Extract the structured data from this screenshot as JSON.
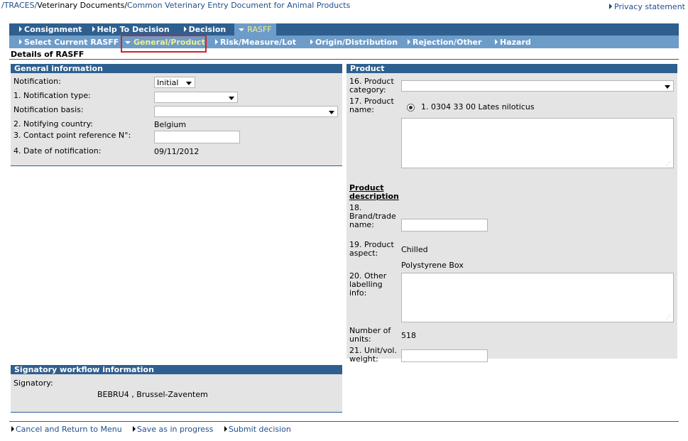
{
  "breadcrumb": {
    "part1": "/TRACES/",
    "part2": "Veterinary Documents/",
    "part3": "Common Veterinary Entry Document for Animal Products"
  },
  "privacy": "Privacy statement",
  "main_tabs": [
    "Consignment",
    "Help To Decision",
    "Decision",
    "RASFF"
  ],
  "sub_tabs": [
    "Select Current RASFF",
    "General/Product",
    "Risk/Measure/Lot",
    "Origin/Distribution",
    "Rejection/Other",
    "Hazard"
  ],
  "details_title": "Details of RASFF",
  "general": {
    "heading": "General information",
    "notification_label": "Notification:",
    "notification_value": "Initial",
    "type_label": "1. Notification type:",
    "type_value": "",
    "basis_label": "Notification basis:",
    "basis_value": "",
    "country_label": "2. Notifying country:",
    "country_value": "Belgium",
    "contact_label": "3. Contact point reference N°:",
    "contact_value": "",
    "date_label": "4. Date of notification:",
    "date_value": "09/11/2012"
  },
  "product": {
    "heading": "Product",
    "category_label1": "16. Product",
    "category_label2": "category:",
    "name_label1": "17. Product",
    "name_label2": "name:",
    "name_option": "1. 0304 33 00 Lates niloticus",
    "description_heading1": "Product",
    "description_heading2": "description",
    "brand_label1": "18.",
    "brand_label2": "Brand/trade",
    "brand_label3": "name:",
    "aspect_label1": "19. Product",
    "aspect_label2": "aspect:",
    "aspect_value": "Chilled",
    "packaging_value": "Polystyrene Box",
    "other_label1": "20. Other",
    "other_label2": "labelling",
    "other_label3": "info:",
    "units_label1": "Number of",
    "units_label2": "units:",
    "units_value": "518",
    "weight_label1": "21. Unit/vol.",
    "weight_label2": "weight:"
  },
  "signatory": {
    "heading": "Signatory workflow information",
    "label": "Signatory:",
    "value": "BEBRU4 , Brussel-Zaventem"
  },
  "bottom_links": [
    "Cancel and Return to Menu",
    "Save as in progress",
    "Submit decision"
  ],
  "colors": {
    "nav_dark": "#2e5f8f",
    "nav_light": "#6d9cc9",
    "active_tab": "#f4f18a",
    "highlight_box": "#d2232a",
    "panel_bg": "#e4e4e4"
  }
}
